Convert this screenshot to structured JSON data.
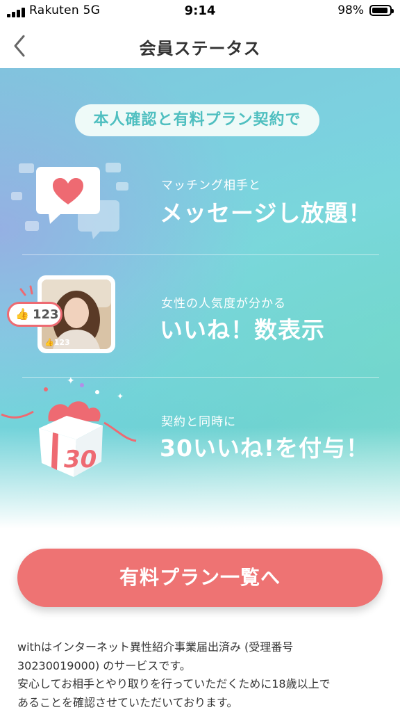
{
  "status_bar": {
    "carrier": "Rakuten   5G",
    "time": "9:14",
    "battery": "98%"
  },
  "nav": {
    "title": "会員ステータス"
  },
  "hero": {
    "banner": "本人確認と有料プラン契約で",
    "features": [
      {
        "caption": "マッチング相手と",
        "headline": "メッセージし放題！"
      },
      {
        "caption": "女性の人気度が分かる",
        "headline": "いいね！数表示",
        "like_count_large": "123",
        "like_count_small": "123"
      },
      {
        "caption": "契約と同時に",
        "headline": "30いいね!を付与！",
        "gift_number": "30"
      }
    ]
  },
  "cta": {
    "label": "有料プラン一覧へ"
  },
  "notes": [
    "withはインターネット異性紹介事業届出済み (受理番号",
    "30230019000) のサービスです。",
    "安心してお相手とやり取りを行っていただくために18歳以上で",
    "あることを確認させていただいております。"
  ],
  "colors": {
    "accent": "#ee7373",
    "teal": "#4fbfc0",
    "heart": "#ee6a72"
  }
}
